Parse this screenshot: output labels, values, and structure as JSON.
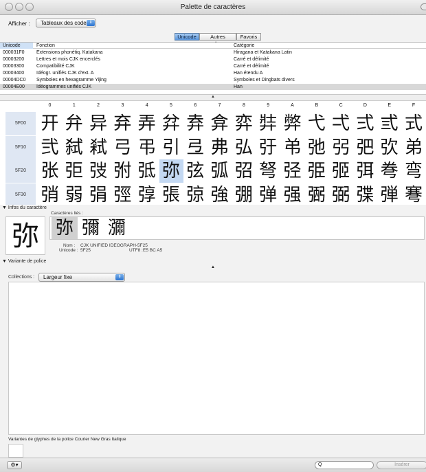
{
  "window": {
    "title": "Palette de caractères"
  },
  "show": {
    "label": "Afficher :",
    "value": "Tableaux des codes"
  },
  "tabs": [
    {
      "label": "Unicode",
      "active": true
    },
    {
      "label": "Autres codages",
      "active": false
    },
    {
      "label": "Favoris",
      "active": false
    }
  ],
  "table": {
    "headers": [
      "Unicode",
      "Fonction",
      "Catégorie"
    ],
    "rows": [
      [
        "000031F0",
        "Extensions phonétiq. Katakana",
        "Hiragana et Katakana Latin"
      ],
      [
        "00003200",
        "Lettres et mois CJK encerclés",
        "Carré et délimité"
      ],
      [
        "00003300",
        "Compatibilité CJK",
        "Carré et délimité"
      ],
      [
        "00003400",
        "Idéogr. unifiés CJK d'ext. A",
        "Han étendu A"
      ],
      [
        "00004DC0",
        "Symboles en hexagramme Yijing",
        "Symboles et Dingbats divers"
      ],
      [
        "00004E00",
        "Idéogrammes unifiés CJK",
        "Han"
      ]
    ],
    "selected_row": 5
  },
  "grid": {
    "columns": [
      "0",
      "1",
      "2",
      "3",
      "4",
      "5",
      "6",
      "7",
      "8",
      "9",
      "A",
      "B",
      "C",
      "D",
      "E",
      "F"
    ],
    "rows": [
      {
        "label": "5F00",
        "chars": [
          "开",
          "弁",
          "异",
          "弃",
          "弄",
          "弅",
          "弆",
          "弇",
          "弈",
          "弉",
          "弊",
          "弋",
          "弌",
          "弍",
          "弎",
          "式"
        ]
      },
      {
        "label": "5F10",
        "chars": [
          "弐",
          "弑",
          "弒",
          "弓",
          "弔",
          "引",
          "弖",
          "弗",
          "弘",
          "弙",
          "弚",
          "弛",
          "弜",
          "弝",
          "弞",
          "弟"
        ]
      },
      {
        "label": "5F20",
        "chars": [
          "张",
          "弡",
          "弢",
          "弣",
          "弤",
          "弥",
          "弦",
          "弧",
          "弨",
          "弩",
          "弪",
          "弫",
          "弬",
          "弭",
          "弮",
          "弯"
        ]
      },
      {
        "label": "5F30",
        "chars": [
          "弰",
          "弱",
          "弲",
          "弳",
          "弴",
          "張",
          "弶",
          "強",
          "弸",
          "弹",
          "强",
          "弻",
          "弼",
          "弽",
          "弾",
          "弿"
        ]
      }
    ],
    "highlight": {
      "row": 2,
      "col": 5
    }
  },
  "char_info": {
    "header": "Infos du caractère",
    "glyph": "弥",
    "related_label": "Caractères liés :",
    "related": [
      "弥",
      "彌",
      "瀰"
    ],
    "name_label": "Nom :",
    "name": "CJK UNIFIED IDEOGRAPH-5F25",
    "unicode_label": "Unicode :",
    "unicode": "5F25",
    "utf8_label": "UTF8 :",
    "utf8": "E5 BC A5"
  },
  "font_variation": {
    "header": "Variante de police",
    "collections_label": "Collections :",
    "collections_value": "Largeur fixe",
    "glyph_variants_label": "Variantes de glyphes de la police Courier New Gras Italique"
  },
  "bottom": {
    "search_placeholder": "Q",
    "insert_label": "Insérer"
  },
  "colors": {
    "accent": "#5a96dc",
    "highlight": "#c3d8f2"
  }
}
